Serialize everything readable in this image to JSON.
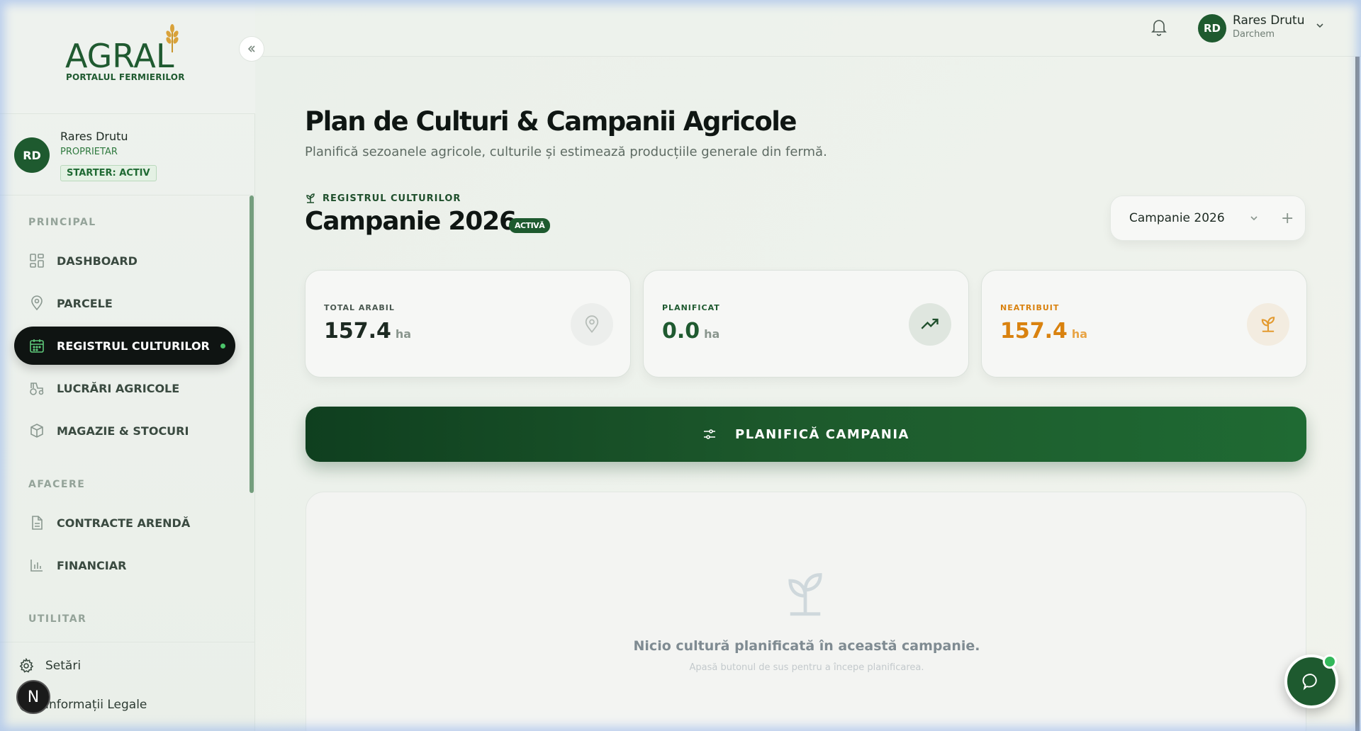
{
  "brand": {
    "logo_text": "AGRAL",
    "logo_subtitle": "PORTALUL FERMIERILOR"
  },
  "profile": {
    "initials": "RD",
    "name": "Rares Drutu",
    "role": "PROPRIETAR",
    "plan_badge": "STARTER: ACTIV"
  },
  "topbar": {
    "initials": "RD",
    "name": "Rares Drutu",
    "company": "Darchem",
    "icons": [
      "bell-icon",
      "chevron-down-icon"
    ]
  },
  "sidebar": {
    "sections": {
      "principal": "PRINCIPAL",
      "afacere": "AFACERE",
      "utilitar": "UTILITAR"
    },
    "items": [
      {
        "label": "DASHBOARD",
        "icon": "dashboard-icon"
      },
      {
        "label": "PARCELE",
        "icon": "map-pin-icon"
      },
      {
        "label": "REGISTRUL CULTURILOR",
        "icon": "calendar-icon",
        "active": true
      },
      {
        "label": "LUCRĂRI AGRICOLE",
        "icon": "tractor-icon"
      },
      {
        "label": "MAGAZIE & STOCURI",
        "icon": "box-icon"
      },
      {
        "label": "CONTRACTE ARENDĂ",
        "icon": "document-icon"
      },
      {
        "label": "FINANCIAR",
        "icon": "bar-chart-icon"
      }
    ],
    "bottom": [
      {
        "label": "Setări",
        "icon": "gear-icon"
      },
      {
        "label": "Informații Legale",
        "icon": "info-icon"
      }
    ],
    "floating_initial": "N"
  },
  "main": {
    "title": "Plan de Culturi & Campanii Agricole",
    "subtitle": "Planifică sezoanele agricole, culturile și estimează producțiile generale din fermă.",
    "registry_label": "REGISTRUL CULTURILOR",
    "campaign_title": "Campanie 2026",
    "campaign_badge": "ACTIVĂ",
    "campaign_select": {
      "value": "Campanie 2026",
      "add_symbol": "+"
    },
    "stats": [
      {
        "label": "TOTAL ARABIL",
        "value": "157.4",
        "unit": "ha",
        "icon": "map-pin-icon",
        "color": "#1d2a22"
      },
      {
        "label": "PLANIFICAT",
        "value": "0.0",
        "unit": "ha",
        "icon": "trending-up-icon",
        "color": "#1f5a30"
      },
      {
        "label": "NEATRIBUIT",
        "value": "157.4",
        "unit": "ha",
        "icon": "sprout-icon",
        "color": "#d9820f"
      }
    ],
    "plan_button": "PLANIFICĂ CAMPANIA",
    "empty": {
      "title": "Nicio cultură planificată în această campanie.",
      "subtitle": "Apasă butonul de sus pentru a începe planificarea."
    }
  },
  "colors": {
    "brand_green": "#1e5a2f",
    "accent_orange": "#d9820f",
    "active_nav_bg": "#0f1412"
  }
}
